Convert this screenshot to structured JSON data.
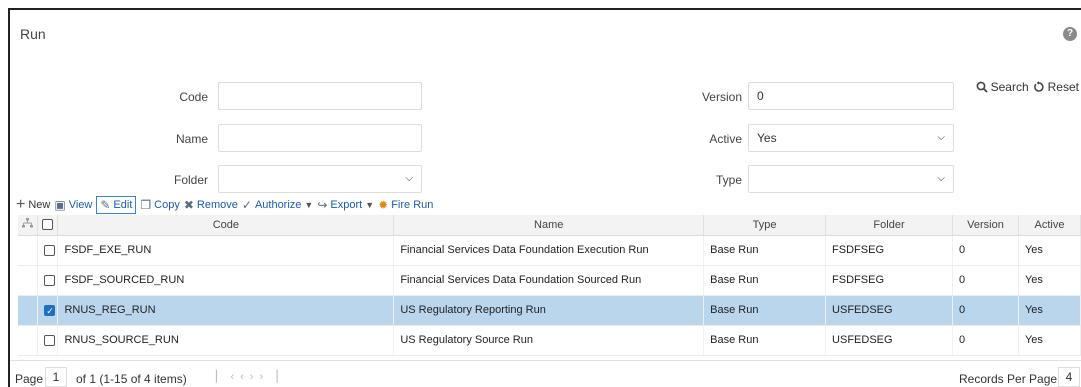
{
  "page": {
    "title": "Run",
    "help": "?"
  },
  "actions": {
    "search": "Search",
    "reset": "Reset"
  },
  "form": {
    "code": {
      "label": "Code",
      "value": ""
    },
    "name": {
      "label": "Name",
      "value": ""
    },
    "folder": {
      "label": "Folder",
      "value": ""
    },
    "version": {
      "label": "Version",
      "value": "0"
    },
    "active": {
      "label": "Active",
      "value": "Yes"
    },
    "type": {
      "label": "Type",
      "value": ""
    }
  },
  "toolbar": {
    "new": "New",
    "view": "View",
    "edit": "Edit",
    "copy": "Copy",
    "remove": "Remove",
    "authorize": "Authorize",
    "export": "Export",
    "fire_run": "Fire Run"
  },
  "table": {
    "headers": {
      "code": "Code",
      "name": "Name",
      "type": "Type",
      "folder": "Folder",
      "version": "Version",
      "active": "Active"
    },
    "rows": [
      {
        "code": "FSDF_EXE_RUN",
        "name": "Financial Services Data Foundation Execution Run",
        "type": "Base Run",
        "folder": "FSDFSEG",
        "version": "0",
        "active": "Yes",
        "selected": false
      },
      {
        "code": "FSDF_SOURCED_RUN",
        "name": "Financial Services Data Foundation Sourced Run",
        "type": "Base Run",
        "folder": "FSDFSEG",
        "version": "0",
        "active": "Yes",
        "selected": false
      },
      {
        "code": "RNUS_REG_RUN",
        "name": "US Regulatory Reporting Run",
        "type": "Base Run",
        "folder": "USFEDSEG",
        "version": "0",
        "active": "Yes",
        "selected": true
      },
      {
        "code": "RNUS_SOURCE_RUN",
        "name": "US Regulatory Source Run",
        "type": "Base Run",
        "folder": "USFEDSEG",
        "version": "0",
        "active": "Yes",
        "selected": false
      }
    ]
  },
  "pagination": {
    "page_label": "Page",
    "page": "1",
    "info": "of 1 (1-15 of 4 items)",
    "records_label": "Records Per Page",
    "records": "4"
  },
  "icons": {
    "help": "help-icon",
    "search": "search-icon",
    "reset": "reset-icon",
    "new": "plus-icon",
    "view": "view-icon",
    "edit": "edit-icon",
    "copy": "copy-icon",
    "remove": "trash-icon",
    "authorize": "authorize-icon",
    "export": "export-icon",
    "fire_run": "fire-icon",
    "hierarchy": "hierarchy-icon",
    "chevron": "chevron-down-icon"
  }
}
